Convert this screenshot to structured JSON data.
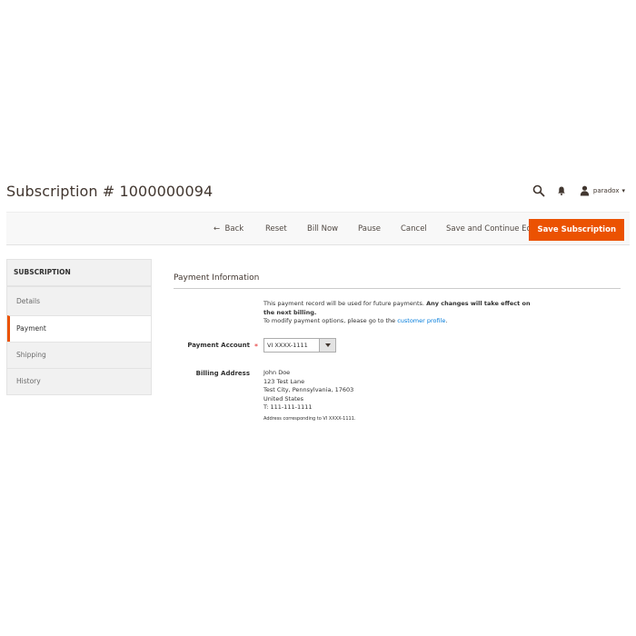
{
  "page": {
    "title": "Subscription # 1000000094"
  },
  "header": {
    "user_name": "paradox",
    "icons": [
      "search-icon",
      "bell-icon",
      "user-icon",
      "caret-down-icon"
    ]
  },
  "actions": {
    "back": "Back",
    "reset": "Reset",
    "bill_now": "Bill Now",
    "pause": "Pause",
    "cancel": "Cancel",
    "save_continue": "Save and Continue Edit",
    "save": "Save Subscription"
  },
  "sidebar": {
    "title": "SUBSCRIPTION",
    "items": [
      {
        "label": "Details",
        "active": false
      },
      {
        "label": "Payment",
        "active": true
      },
      {
        "label": "Shipping",
        "active": false
      },
      {
        "label": "History",
        "active": false
      }
    ]
  },
  "main": {
    "section_title": "Payment Information",
    "note_line1": "This payment record will be used for future payments.",
    "note_bold": "Any changes will take effect on the next billing.",
    "note_line2_prefix": "To modify payment options, please go to the",
    "note_link": "customer profile",
    "note_line2_suffix": ".",
    "payment_account_label": "Payment Account",
    "payment_account_value": "VI XXXX-1111",
    "billing_address_label": "Billing Address",
    "billing_address": {
      "name": "John Doe",
      "street": "123 Test Lane",
      "city_line": "Test City, Pennsylvania, 17603",
      "country": "United States",
      "phone": "T: 111-111-1111",
      "note": "Address corresponding to VI XXXX-1111."
    }
  },
  "colors": {
    "accent": "#eb5202",
    "link": "#007bdb",
    "required": "#e22626"
  }
}
